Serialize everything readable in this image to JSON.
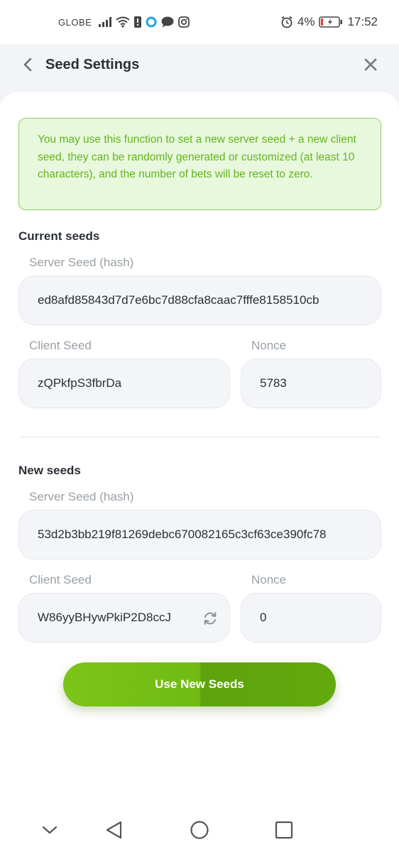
{
  "status_bar": {
    "carrier": "GLOBE",
    "battery_percent": "4%",
    "time": "17:52",
    "icons": [
      "signal-icon",
      "wifi-icon",
      "alert-icon",
      "app-icon",
      "chat-icon",
      "instagram-icon",
      "alarm-icon",
      "battery-icon"
    ]
  },
  "header": {
    "title": "Seed Settings",
    "back_icon": "chevron-left-icon",
    "close_icon": "close-icon"
  },
  "info": {
    "text": "You may use this function to set a new server seed + a new client seed, they can be randomly generated or customized (at least 10 characters), and the number of bets will be reset to zero."
  },
  "current_seeds": {
    "title": "Current seeds",
    "server_seed_label": "Server Seed (hash)",
    "server_seed_value": "ed8afd85843d7d7e6bc7d88cfa8caac7fffe8158510cb",
    "client_seed_label": "Client Seed",
    "client_seed_value": "zQPkfpS3fbrDa",
    "nonce_label": "Nonce",
    "nonce_value": "5783"
  },
  "new_seeds": {
    "title": "New seeds",
    "server_seed_label": "Server Seed (hash)",
    "server_seed_value": "53d2b3bb219f81269debc670082165c3cf63ce390fc78",
    "client_seed_label": "Client Seed",
    "client_seed_value": "W86yyBHywPkiP2D8ccJ",
    "nonce_label": "Nonce",
    "nonce_value": "0",
    "refresh_icon": "refresh-icon"
  },
  "cta": {
    "label": "Use New Seeds"
  },
  "colors": {
    "accent_green": "#6fbb13",
    "info_text": "#62b51f",
    "info_bg": "#e8f8dd",
    "info_border": "#8fd15a"
  }
}
